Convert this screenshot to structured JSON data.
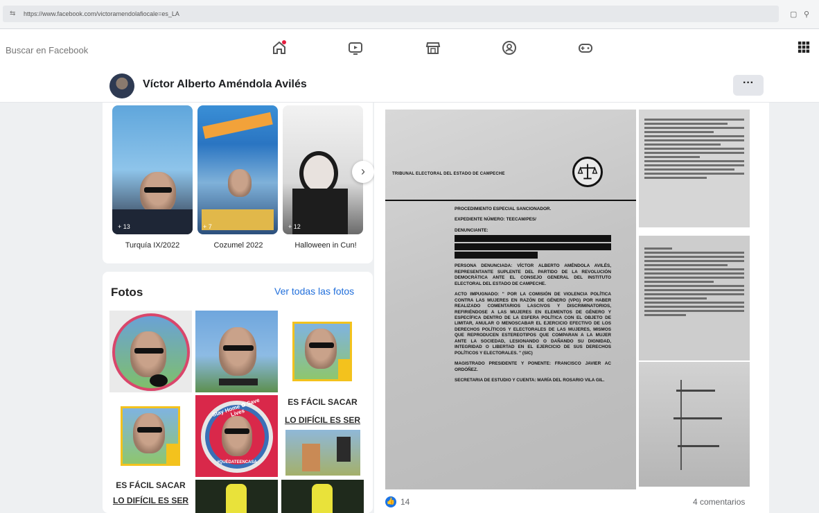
{
  "browser": {
    "url": "https://www.facebook.com/victoramendolafiocale=es_LA"
  },
  "topbar": {
    "search_placeholder": "Buscar en Facebook",
    "nav_icons": [
      "home-icon",
      "video-icon",
      "marketplace-icon",
      "groups-icon",
      "gaming-icon"
    ],
    "menu_icon": "grid-menu-icon"
  },
  "profile": {
    "name": "Víctor Alberto Améndola Avilés",
    "more_label": "···"
  },
  "stories": {
    "items": [
      {
        "label": "Turquía IX/2022",
        "count": "+ 13"
      },
      {
        "label": "Cozumel 2022",
        "count": "+ 7"
      },
      {
        "label": "Halloween in Cun!",
        "count": "+ 12"
      }
    ]
  },
  "photos": {
    "title": "Fotos",
    "see_all": "Ver todas las fotos",
    "meme1_big": "ES FÁCIL SACAR",
    "meme1_big2": "LO DIFÍCIL ES SER",
    "meme2_big": "ES FÁCIL SACAR",
    "meme2_big2": "LO DIFÍCIL ES SER",
    "stay_home": "Stay Home ✿ Save Lives",
    "quarantine": "#QUÉDATEENCASA"
  },
  "post": {
    "doc_heading": "TRIBUNAL ELECTORAL DEL ESTADO DE CAMPECHE",
    "doc_procedure": "PROCEDIMIENTO ESPECIAL SANCIONADOR.",
    "doc_expediente": "EXPEDIENTE NÚMERO: TEECAM/PES/",
    "doc_denunciante": "DENUNCIANTE:",
    "doc_denunciado": "PERSONA DENUNCIADA: VÍCTOR ALBERTO AMÉNDOLA AVILÉS, REPRESENTANTE SUPLENTE DEL PARTIDO DE LA REVOLUCIÓN DEMOCRÁTICA ANTE EL CONSEJO GENERAL DEL INSTITUTO ELECTORAL DEL ESTADO DE CAMPECHE.",
    "doc_acto": "ACTO IMPUGNADO: \" POR LA COMISIÓN DE VIOLENCIA POLÍTICA CONTRA LAS MUJERES EN RAZÓN DE GÉNERO (VPG) POR HABER REALIZADO COMENTARIOS LASCIVOS Y DISCRIMINATORIOS, REFIRIÉNDOSE A LAS MUJERES EN ELEMENTOS DE GÉNERO Y ESPECÍFICA DENTRO DE LA ESFERA POLÍTICA CON EL OBJETO DE LIMITAR, ANULAR O MENOSCABAR EL EJERCICIO EFECTIVO DE LOS DERECHOS POLÍTICOS Y ELECTORALES DE LAS MUJERES, MISMOS QUE REPRODUCEN ESTEREOTIPOS QUE COMPARAN A LA MUJER ANTE LA SOCIEDAD, LESIONANDO O DAÑANDO SU DIGNIDAD, INTEGRIDAD O LIBERTAD EN EL EJERCICIO DE SUS DERECHOS POLÍTICOS Y ELECTORALES. \" (sic)",
    "doc_magistrado": "MAGISTRADO PRESIDENTE Y PONENTE: FRANCISCO JAVIER AC ORDÓÑEZ.",
    "doc_secretaria": "SECRETARIA DE ESTUDIO Y CUENTA: MARÍA DEL ROSARIO VILA GIL.",
    "likes": "14",
    "comments": "4 comentarios"
  }
}
